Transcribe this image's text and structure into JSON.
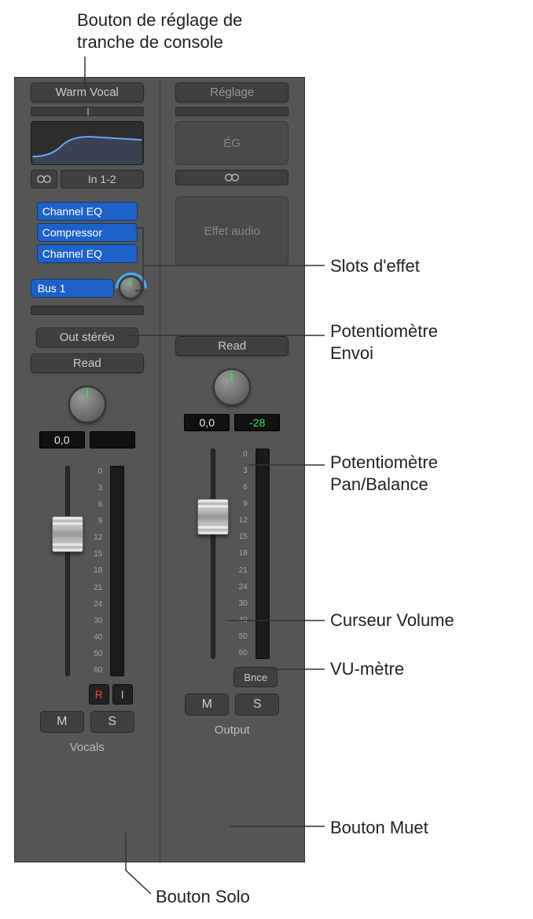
{
  "labels": {
    "setting_button": "Bouton de réglage de\ntranche de console",
    "effect_slots": "Slots d'effet",
    "send_knob": "Potentiomètre\nEnvoi",
    "pan_knob": "Potentiomètre\nPan/Balance",
    "volume_fader": "Curseur Volume",
    "vu_meter": "VU-mètre",
    "mute_button": "Bouton Muet",
    "solo_button": "Bouton Solo"
  },
  "strip1": {
    "setting": "Warm Vocal",
    "input": "In 1-2",
    "effects": [
      "Channel EQ",
      "Compressor",
      "Channel EQ"
    ],
    "bus": "Bus 1",
    "output": "Out stéréo",
    "automation": "Read",
    "pan_value": "0,0",
    "peak_value": "",
    "rec": "R",
    "input_mon": "I",
    "mute": "M",
    "solo": "S",
    "name": "Vocals"
  },
  "strip2": {
    "setting": "Réglage",
    "eq_label": "ÉG",
    "fx_placeholder": "Effet audio",
    "automation": "Read",
    "pan_value": "0,0",
    "peak_value": "-28",
    "bounce": "Bnce",
    "mute": "M",
    "solo": "S",
    "name": "Output"
  },
  "fader_scale": [
    "0",
    "3",
    "6",
    "9",
    "12",
    "15",
    "18",
    "21",
    "24",
    "30",
    "40",
    "50",
    "60"
  ]
}
